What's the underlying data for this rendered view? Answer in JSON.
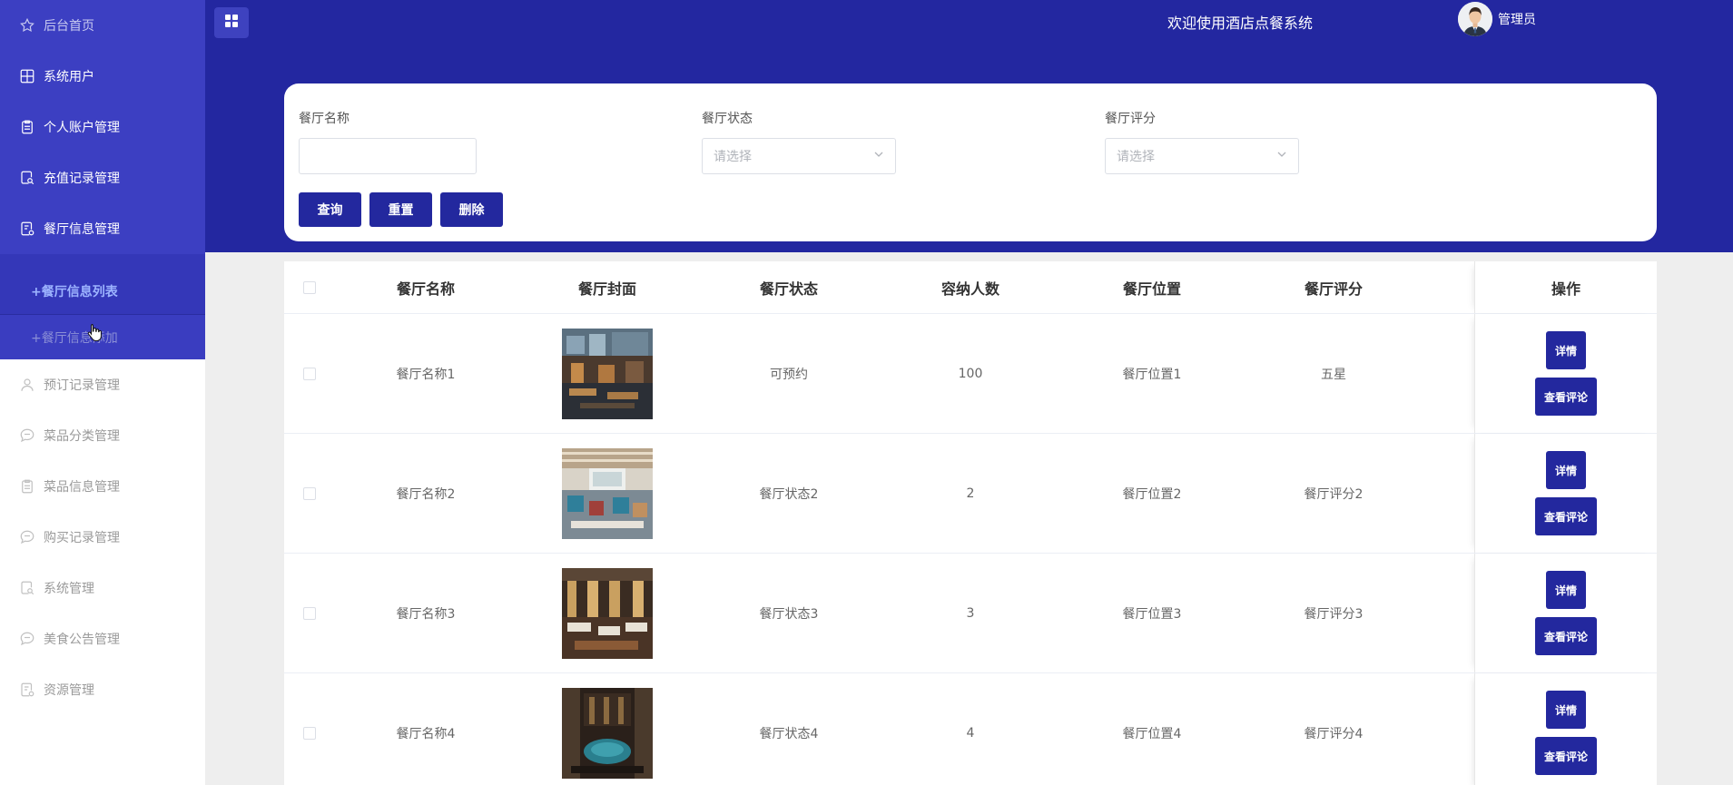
{
  "header": {
    "title": "欢迎使用酒店点餐系统",
    "username": "管理员"
  },
  "sidebar": {
    "items_top": [
      {
        "label": "后台首页",
        "icon": "star-icon"
      },
      {
        "label": "系统用户",
        "icon": "grid-icon"
      },
      {
        "label": "个人账户管理",
        "icon": "clipboard-icon"
      },
      {
        "label": "充值记录管理",
        "icon": "doc-search-icon"
      },
      {
        "label": "餐厅信息管理",
        "icon": "doc-list-icon"
      }
    ],
    "submenu": [
      {
        "label": "+餐厅信息列表"
      },
      {
        "label": "+餐厅信息添加"
      }
    ],
    "items_bottom": [
      {
        "label": "预订记录管理",
        "icon": "user-icon"
      },
      {
        "label": "菜品分类管理",
        "icon": "chat-icon"
      },
      {
        "label": "菜品信息管理",
        "icon": "clipboard-icon"
      },
      {
        "label": "购买记录管理",
        "icon": "chat-icon"
      },
      {
        "label": "系统管理",
        "icon": "doc-search-icon"
      },
      {
        "label": "美食公告管理",
        "icon": "chat-icon"
      },
      {
        "label": "资源管理",
        "icon": "doc-list-icon"
      }
    ]
  },
  "search": {
    "name_label": "餐厅名称",
    "status_label": "餐厅状态",
    "status_placeholder": "请选择",
    "rating_label": "餐厅评分",
    "rating_placeholder": "请选择",
    "query_button": "查询",
    "reset_button": "重置",
    "delete_button": "删除"
  },
  "table": {
    "headers": [
      "餐厅名称",
      "餐厅封面",
      "餐厅状态",
      "容纳人数",
      "餐厅位置",
      "餐厅评分",
      "操作"
    ],
    "detail_label": "详情",
    "comment_label": "查看评论",
    "rows": [
      {
        "name": "餐厅名称1",
        "status": "可预约",
        "capacity": "100",
        "location": "餐厅位置1",
        "rating": "五星"
      },
      {
        "name": "餐厅名称2",
        "status": "餐厅状态2",
        "capacity": "2",
        "location": "餐厅位置2",
        "rating": "餐厅评分2"
      },
      {
        "name": "餐厅名称3",
        "status": "餐厅状态3",
        "capacity": "3",
        "location": "餐厅位置3",
        "rating": "餐厅评分3"
      },
      {
        "name": "餐厅名称4",
        "status": "餐厅状态4",
        "capacity": "4",
        "location": "餐厅位置4",
        "rating": "餐厅评分4"
      }
    ]
  },
  "colors": {
    "primary": "#23289e",
    "sidebar_active": "#3c3fc2",
    "header_bg": "#2327a0"
  }
}
